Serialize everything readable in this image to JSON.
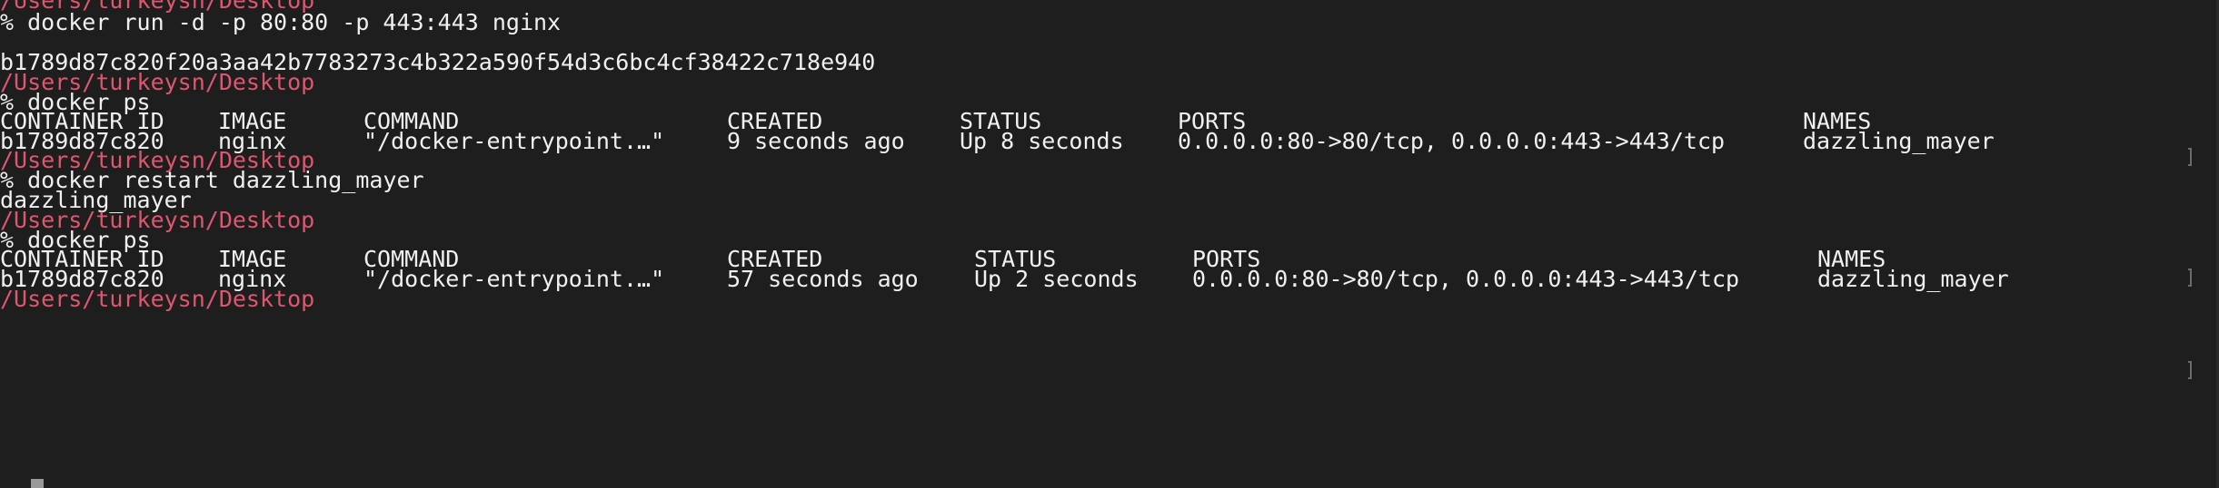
{
  "terminal": {
    "background": "#1e1e1e",
    "path_color": "#e0566f",
    "text_color": "#f0f0f0",
    "lines": {
      "path_top": "/Users/turkeysn/Desktop",
      "cmd_run": "% docker run -d -p 80:80 -p 443:443 nginx",
      "container_hash": "b1789d87c820f20a3aa42b7783273c4b322a590f54d3c6bc4cf38422c718e940",
      "path_1": "/Users/turkeysn/Desktop",
      "cmd_ps_1": "% docker ps",
      "path_2": "/Users/turkeysn/Desktop",
      "cmd_restart": "% docker restart dazzling_mayer",
      "restart_output": "dazzling_mayer",
      "path_3": "/Users/turkeysn/Desktop",
      "cmd_ps_2": "% docker ps",
      "path_4": "/Users/turkeysn/Desktop"
    },
    "ps_1": {
      "headers": {
        "container_id": "CONTAINER ID",
        "image": "IMAGE",
        "command": "COMMAND",
        "created": "CREATED",
        "status": "STATUS",
        "ports": "PORTS",
        "names": "NAMES"
      },
      "row": {
        "container_id": "b1789d87c820",
        "image": "nginx",
        "command": "\"/docker-entrypoint.…\"",
        "created": "9 seconds ago",
        "status": "Up 8 seconds",
        "ports": "0.0.0.0:80->80/tcp, 0.0.0.0:443->443/tcp",
        "names": "dazzling_mayer"
      }
    },
    "ps_2": {
      "headers": {
        "container_id": "CONTAINER ID",
        "image": "IMAGE",
        "command": "COMMAND",
        "created": "CREATED",
        "status": "STATUS",
        "ports": "PORTS",
        "names": "NAMES"
      },
      "row": {
        "container_id": "b1789d87c820",
        "image": "nginx",
        "command": "\"/docker-entrypoint.…\"",
        "created": "57 seconds ago",
        "status": "Up 2 seconds",
        "ports": "0.0.0.0:80->80/tcp, 0.0.0.0:443->443/tcp",
        "names": "dazzling_mayer"
      }
    }
  }
}
